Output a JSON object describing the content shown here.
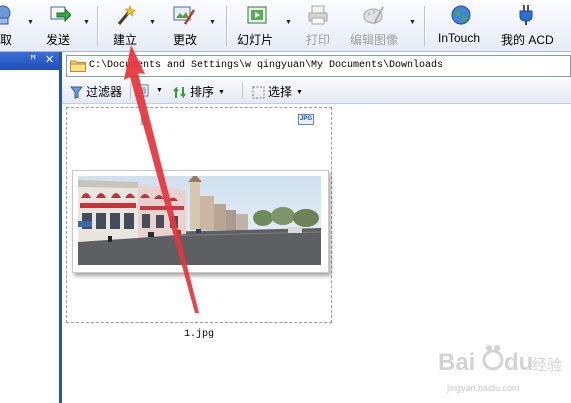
{
  "toolbar": {
    "items": [
      {
        "label": "取",
        "icon": "acquire-icon",
        "disabled": false
      },
      {
        "label": "发送",
        "icon": "send-icon",
        "disabled": false
      },
      {
        "label": "建立",
        "icon": "create-wand-icon",
        "disabled": false
      },
      {
        "label": "更改",
        "icon": "edit-paint-icon",
        "disabled": false
      },
      {
        "label": "幻灯片",
        "icon": "slideshow-icon",
        "disabled": false
      },
      {
        "label": "打印",
        "icon": "printer-icon",
        "disabled": true
      },
      {
        "label": "编辑图像",
        "icon": "edit-image-icon",
        "disabled": true
      },
      {
        "label": "InTouch",
        "icon": "globe-icon",
        "disabled": false
      },
      {
        "label": "我的 ACD",
        "icon": "plug-icon",
        "disabled": false
      }
    ]
  },
  "left_pane": {
    "pin_glyph": "ꟸ",
    "close_glyph": "✕"
  },
  "address": {
    "path": "C:\\Documents and Settings\\w   qingyuan\\My Documents\\Downloads"
  },
  "sub_toolbar": {
    "filter_label": "过滤器",
    "sort_label": "排序",
    "select_label": "选择"
  },
  "browser": {
    "file_name": "1.jpg",
    "file_type_badge": "JPG"
  },
  "watermark": {
    "text": "jingyan.baidu.com"
  },
  "colors": {
    "left_header": "#2a5cc6",
    "annotation_arrow": "#e8343a",
    "toolbar_bg": "#eef2f9"
  }
}
